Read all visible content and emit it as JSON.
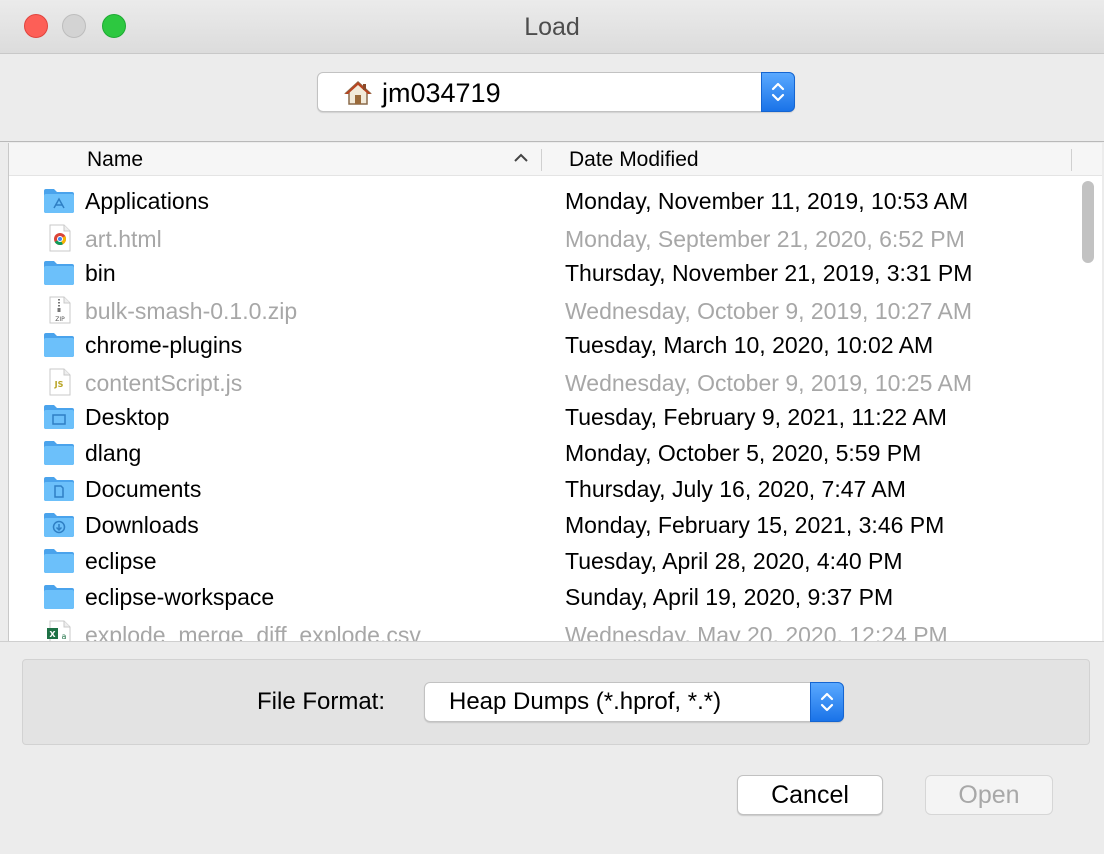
{
  "window": {
    "title": "Load"
  },
  "path_popup": {
    "value": "jm034719",
    "icon": "home-icon"
  },
  "columns": {
    "name": "Name",
    "date_modified": "Date Modified",
    "sort": "ascending"
  },
  "files": [
    {
      "name": "Applications",
      "date": "Monday, November 11, 2019, 10:53 AM",
      "icon": "applications-folder-icon",
      "enabled": true
    },
    {
      "name": "art.html",
      "date": "Monday, September 21, 2020, 6:52 PM",
      "icon": "chrome-html-icon",
      "enabled": false
    },
    {
      "name": "bin",
      "date": "Thursday, November 21, 2019, 3:31 PM",
      "icon": "folder-icon",
      "enabled": true
    },
    {
      "name": "bulk-smash-0.1.0.zip",
      "date": "Wednesday, October 9, 2019, 10:27 AM",
      "icon": "zip-file-icon",
      "enabled": false
    },
    {
      "name": "chrome-plugins",
      "date": "Tuesday, March 10, 2020, 10:02 AM",
      "icon": "folder-icon",
      "enabled": true
    },
    {
      "name": "contentScript.js",
      "date": "Wednesday, October 9, 2019, 10:25 AM",
      "icon": "js-file-icon",
      "enabled": false
    },
    {
      "name": "Desktop",
      "date": "Tuesday, February 9, 2021, 11:22 AM",
      "icon": "desktop-folder-icon",
      "enabled": true
    },
    {
      "name": "dlang",
      "date": "Monday, October 5, 2020, 5:59 PM",
      "icon": "folder-icon",
      "enabled": true
    },
    {
      "name": "Documents",
      "date": "Thursday, July 16, 2020, 7:47 AM",
      "icon": "documents-folder-icon",
      "enabled": true
    },
    {
      "name": "Downloads",
      "date": "Monday, February 15, 2021, 3:46 PM",
      "icon": "downloads-folder-icon",
      "enabled": true
    },
    {
      "name": "eclipse",
      "date": "Tuesday, April 28, 2020, 4:40 PM",
      "icon": "folder-icon",
      "enabled": true
    },
    {
      "name": "eclipse-workspace",
      "date": "Sunday, April 19, 2020, 9:37 PM",
      "icon": "folder-icon",
      "enabled": true
    },
    {
      "name": "explode_merge_diff_explode.csv",
      "date": "Wednesday, May 20, 2020, 12:24 PM",
      "icon": "excel-csv-icon",
      "enabled": false
    }
  ],
  "file_format": {
    "label": "File Format:",
    "value": "Heap Dumps (*.hprof, *.*)"
  },
  "buttons": {
    "cancel": "Cancel",
    "open": "Open"
  },
  "colors": {
    "folder_blue": "#5fb6f5",
    "stepper_blue": "#1a73e8",
    "dim_text": "#a7a7a7"
  }
}
